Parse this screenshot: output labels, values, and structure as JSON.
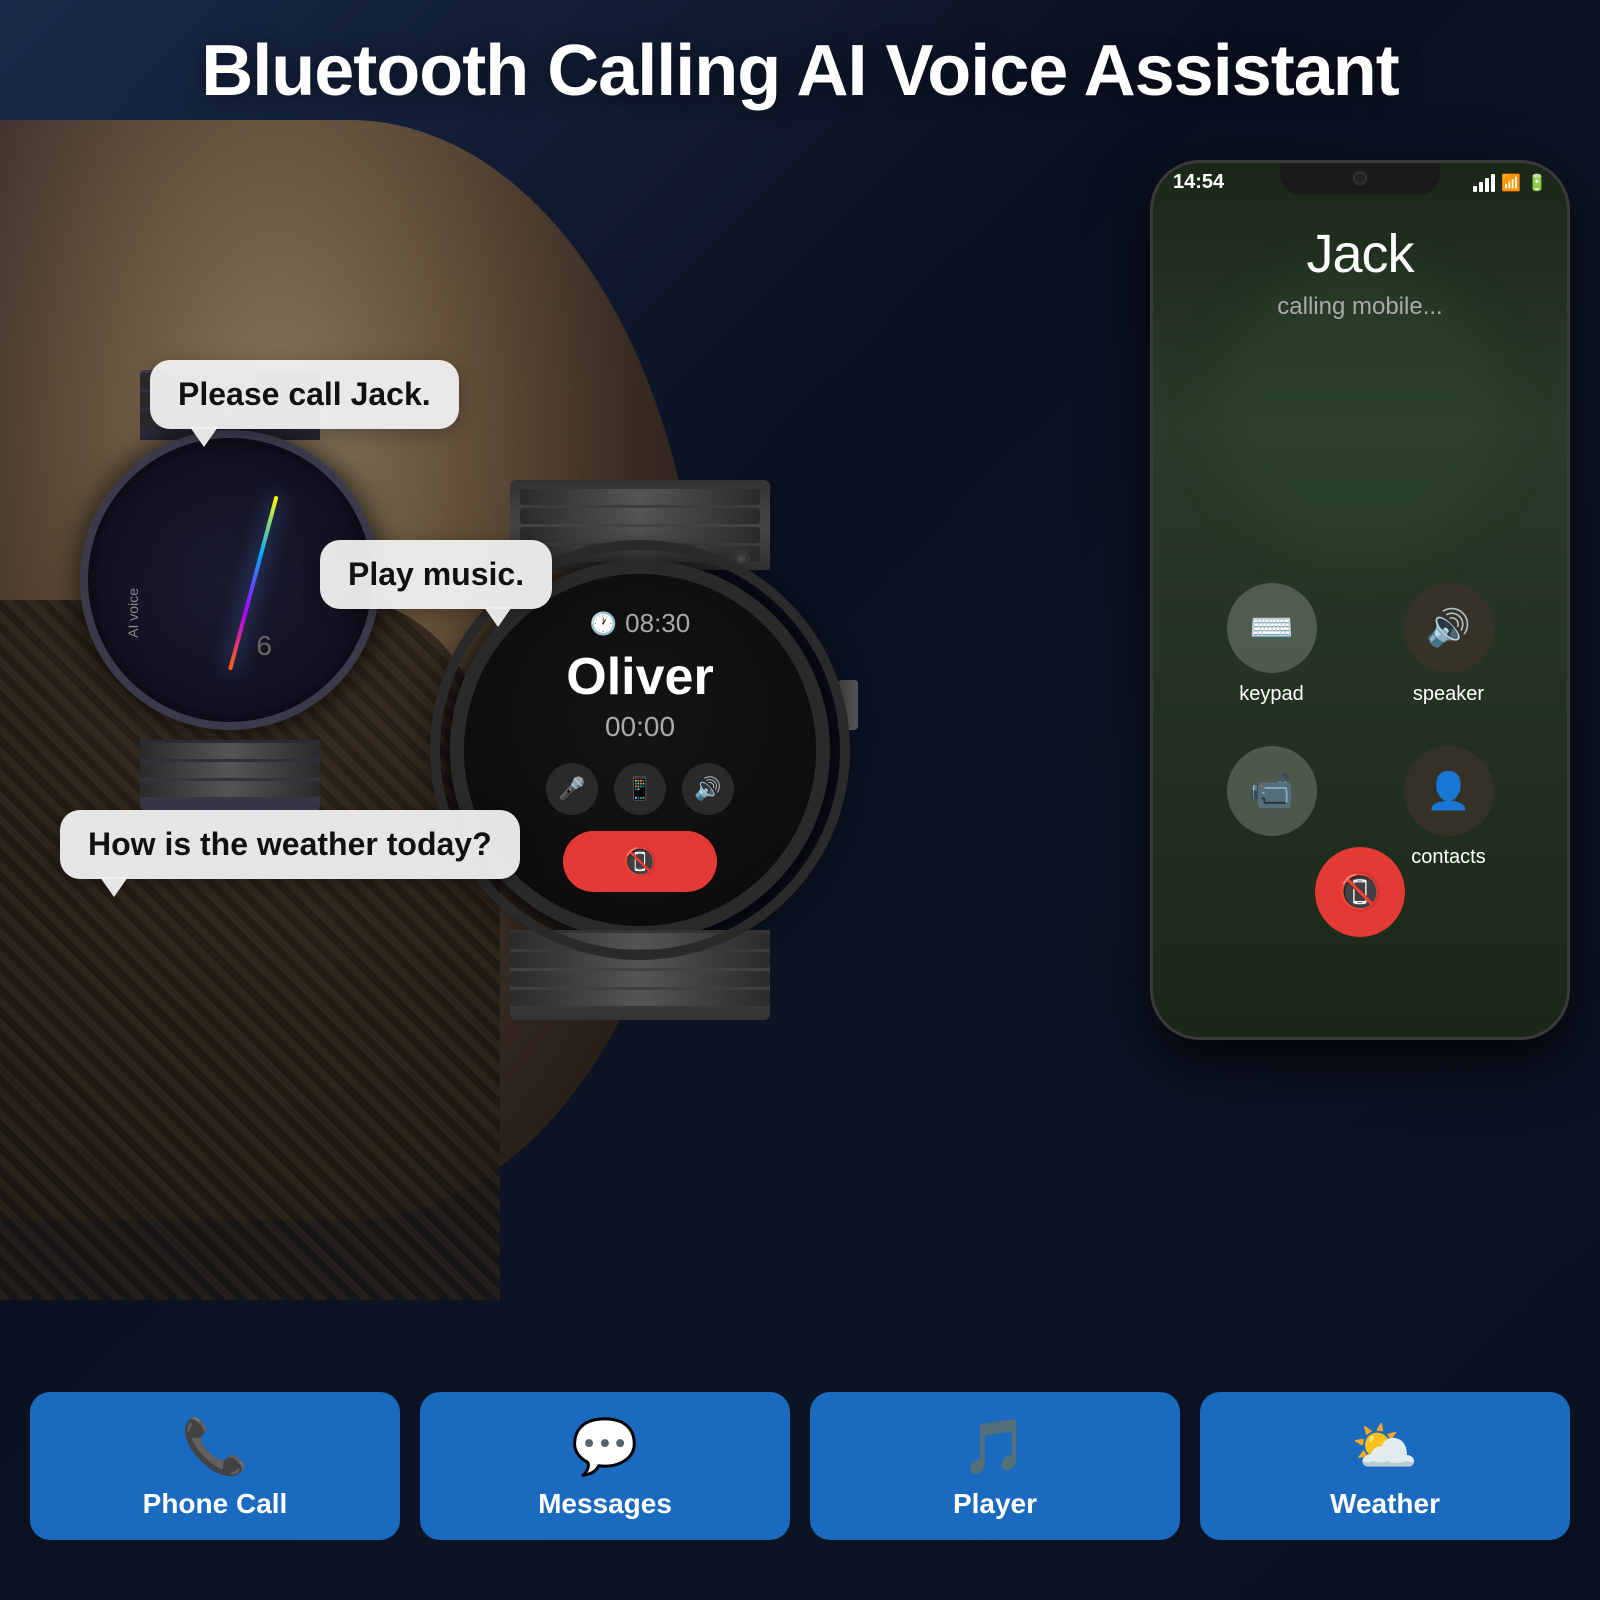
{
  "title": "Bluetooth Calling AI Voice Assistant",
  "bubbles": {
    "bubble1": "Please call Jack.",
    "bubble2": "Play music.",
    "bubble3": "How is the weather today?"
  },
  "watch1": {
    "ai_label": "AI voice",
    "number": "6"
  },
  "watch2": {
    "time": "08:30",
    "caller_name": "Oliver",
    "call_duration": "00:00"
  },
  "phone": {
    "status_time": "14:54",
    "caller_name": "Jack",
    "caller_status": "calling mobile...",
    "actions": {
      "keypad": "keypad",
      "speaker": "speaker",
      "contacts": "contacts"
    }
  },
  "features": [
    {
      "id": "phone-call",
      "label": "Phone Call",
      "icon": "📞"
    },
    {
      "id": "messages",
      "label": "Messages",
      "icon": "💬"
    },
    {
      "id": "player",
      "label": "Player",
      "icon": "🎵"
    },
    {
      "id": "weather",
      "label": "Weather",
      "icon": "⛅"
    }
  ]
}
